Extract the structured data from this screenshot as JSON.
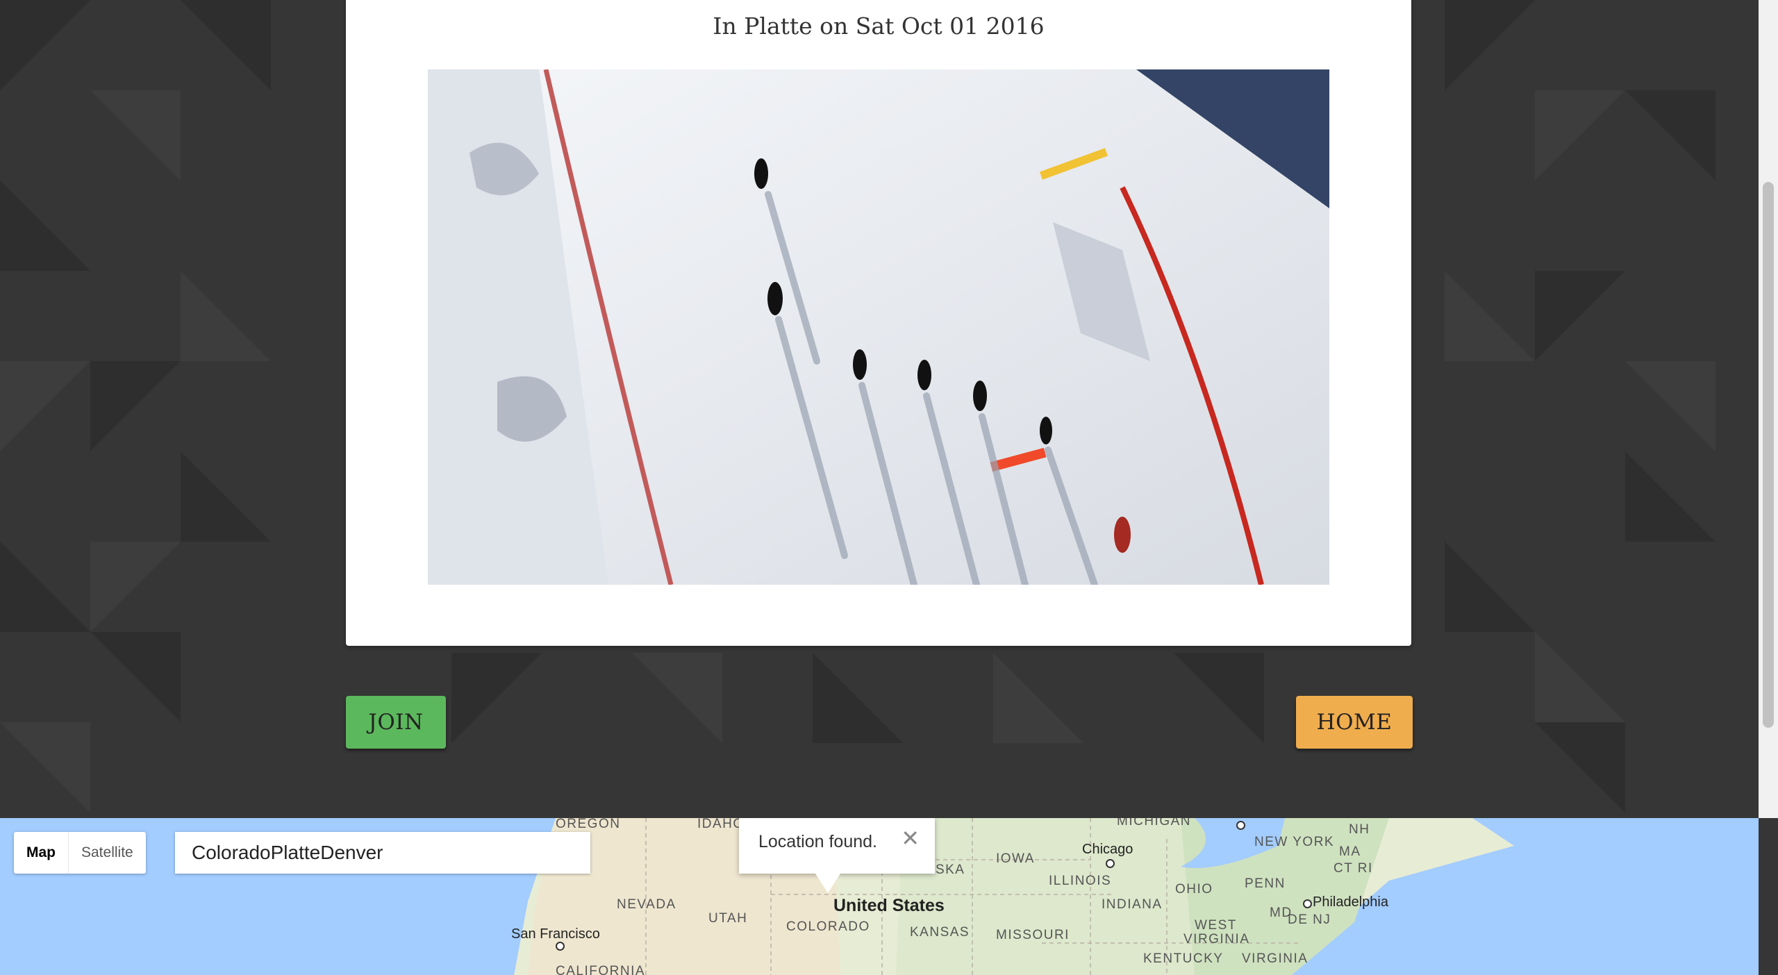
{
  "post": {
    "title": "In Platte on Sat Oct 01 2016"
  },
  "buttons": {
    "join": "JOIN",
    "home": "HOME"
  },
  "map": {
    "type_map": "Map",
    "type_satellite": "Satellite",
    "search_value": "ColoradoPlatteDenver",
    "infowindow_text": "Location found.",
    "close_glyph": "✕",
    "labels": {
      "oregon": "OREGON",
      "idaho": "IDAHO",
      "michigan": "MICHIGAN",
      "nh": "NH",
      "iowa": "IOWA",
      "chicago": "Chicago",
      "new_york": "NEW YORK",
      "ma": "MA",
      "ct_ri": "CT RI",
      "nebraska": "NEBRASKA",
      "illinois": "ILLINOIS",
      "ohio": "OHIO",
      "penn": "PENN",
      "nevada": "NEVADA",
      "utah": "UTAH",
      "united_states": "United States",
      "indiana": "INDIANA",
      "philadelphia": "Philadelphia",
      "md": "MD",
      "de_nj": "DE NJ",
      "colorado": "COLORADO",
      "kansas": "KANSAS",
      "missouri": "MISSOURI",
      "west_virginia_1": "WEST",
      "west_virginia_2": "VIRGINIA",
      "san_francisco": "San Francisco",
      "california": "CALIFORNIA",
      "kentucky": "KENTUCKY",
      "virginia": "VIRGINIA"
    }
  },
  "colors": {
    "join_button": "#5cb85c",
    "home_button": "#f0ad4e",
    "background": "#363636"
  }
}
